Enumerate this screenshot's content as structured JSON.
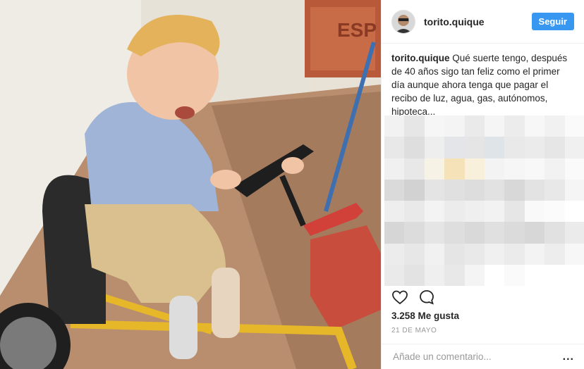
{
  "post": {
    "username": "torito.quique",
    "follow_label": "Seguir",
    "caption_username": "torito.quique",
    "caption_text": "Qué suerte tengo, después de 40 años sigo tan feliz como el primer día aunque ahora tenga que pagar el recibo de luz, agua, gas, autónomos, hipoteca...",
    "likes_text": "3.258 Me gusta",
    "date_text": "21 DE MAYO",
    "comment_placeholder": "Añade un comentario...",
    "more_label": "..."
  },
  "icons": {
    "like": "heart-icon",
    "comment": "comment-icon"
  },
  "colors": {
    "follow_button": "#3897f0",
    "text": "#262626",
    "muted": "#999999"
  }
}
